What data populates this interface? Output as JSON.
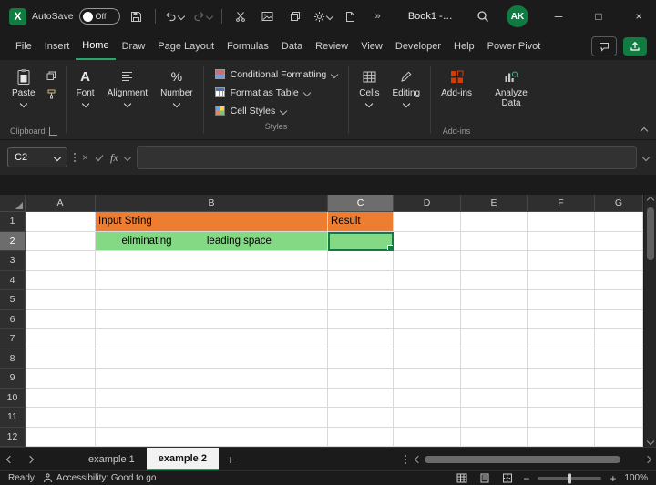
{
  "window": {
    "title": "Book1 -…",
    "autosave_label": "AutoSave",
    "autosave_state": "Off",
    "avatar_initials": "AK"
  },
  "menubar": {
    "active_tab": "Home",
    "tabs": [
      "File",
      "Insert",
      "Home",
      "Draw",
      "Page Layout",
      "Formulas",
      "Data",
      "Review",
      "View",
      "Developer",
      "Help",
      "Power Pivot"
    ]
  },
  "ribbon": {
    "paste_label": "Paste",
    "font_label": "Font",
    "alignment_label": "Alignment",
    "number_label": "Number",
    "styles_items": [
      "Conditional Formatting",
      "Format as Table",
      "Cell Styles"
    ],
    "cells_label": "Cells",
    "editing_label": "Editing",
    "addins_label": "Add-ins",
    "analyze_label": "Analyze Data",
    "group_labels": {
      "clipboard": "Clipboard",
      "styles": "Styles",
      "addins": "Add-ins"
    }
  },
  "formula_bar": {
    "name_box": "C2",
    "fx_label": "fx",
    "value": ""
  },
  "grid": {
    "columns": [
      "A",
      "B",
      "C",
      "D",
      "E",
      "F",
      "G"
    ],
    "rows": [
      "1",
      "2",
      "3",
      "4",
      "5",
      "6",
      "7",
      "8",
      "9",
      "10",
      "11",
      "12"
    ],
    "selected_column": "C",
    "selected_row": "2",
    "selected_cell": "C2",
    "cells": {
      "B1": "Input String",
      "C1": "Result",
      "B2": "        eliminating            leading space"
    },
    "fills": {
      "B1": "orange",
      "C1": "orange",
      "B2": "green",
      "C2": "green"
    },
    "colors": {
      "orange": "#ED7D31",
      "green": "#84D984",
      "selection": "#107C41"
    }
  },
  "sheet_tabs": {
    "tabs": [
      {
        "label": "example 1",
        "active": false
      },
      {
        "label": "example 2",
        "active": true
      }
    ],
    "add_label": "+"
  },
  "status_bar": {
    "ready_label": "Ready",
    "accessibility_label": "Accessibility: Good to go",
    "zoom_level": "100%"
  },
  "icons": {
    "titlebar": [
      "excel-logo",
      "save",
      "undo",
      "redo",
      "cut",
      "picture",
      "copy",
      "settings",
      "new-document",
      "overflow",
      "search"
    ],
    "statusbar_views": [
      "normal-view",
      "page-layout-view",
      "page-break-view"
    ]
  },
  "colors": {
    "accent_green": "#107C41",
    "addins_orange": "#D83B01",
    "titlebar_bg": "#1b1b1b",
    "ribbon_bg": "#262626"
  }
}
